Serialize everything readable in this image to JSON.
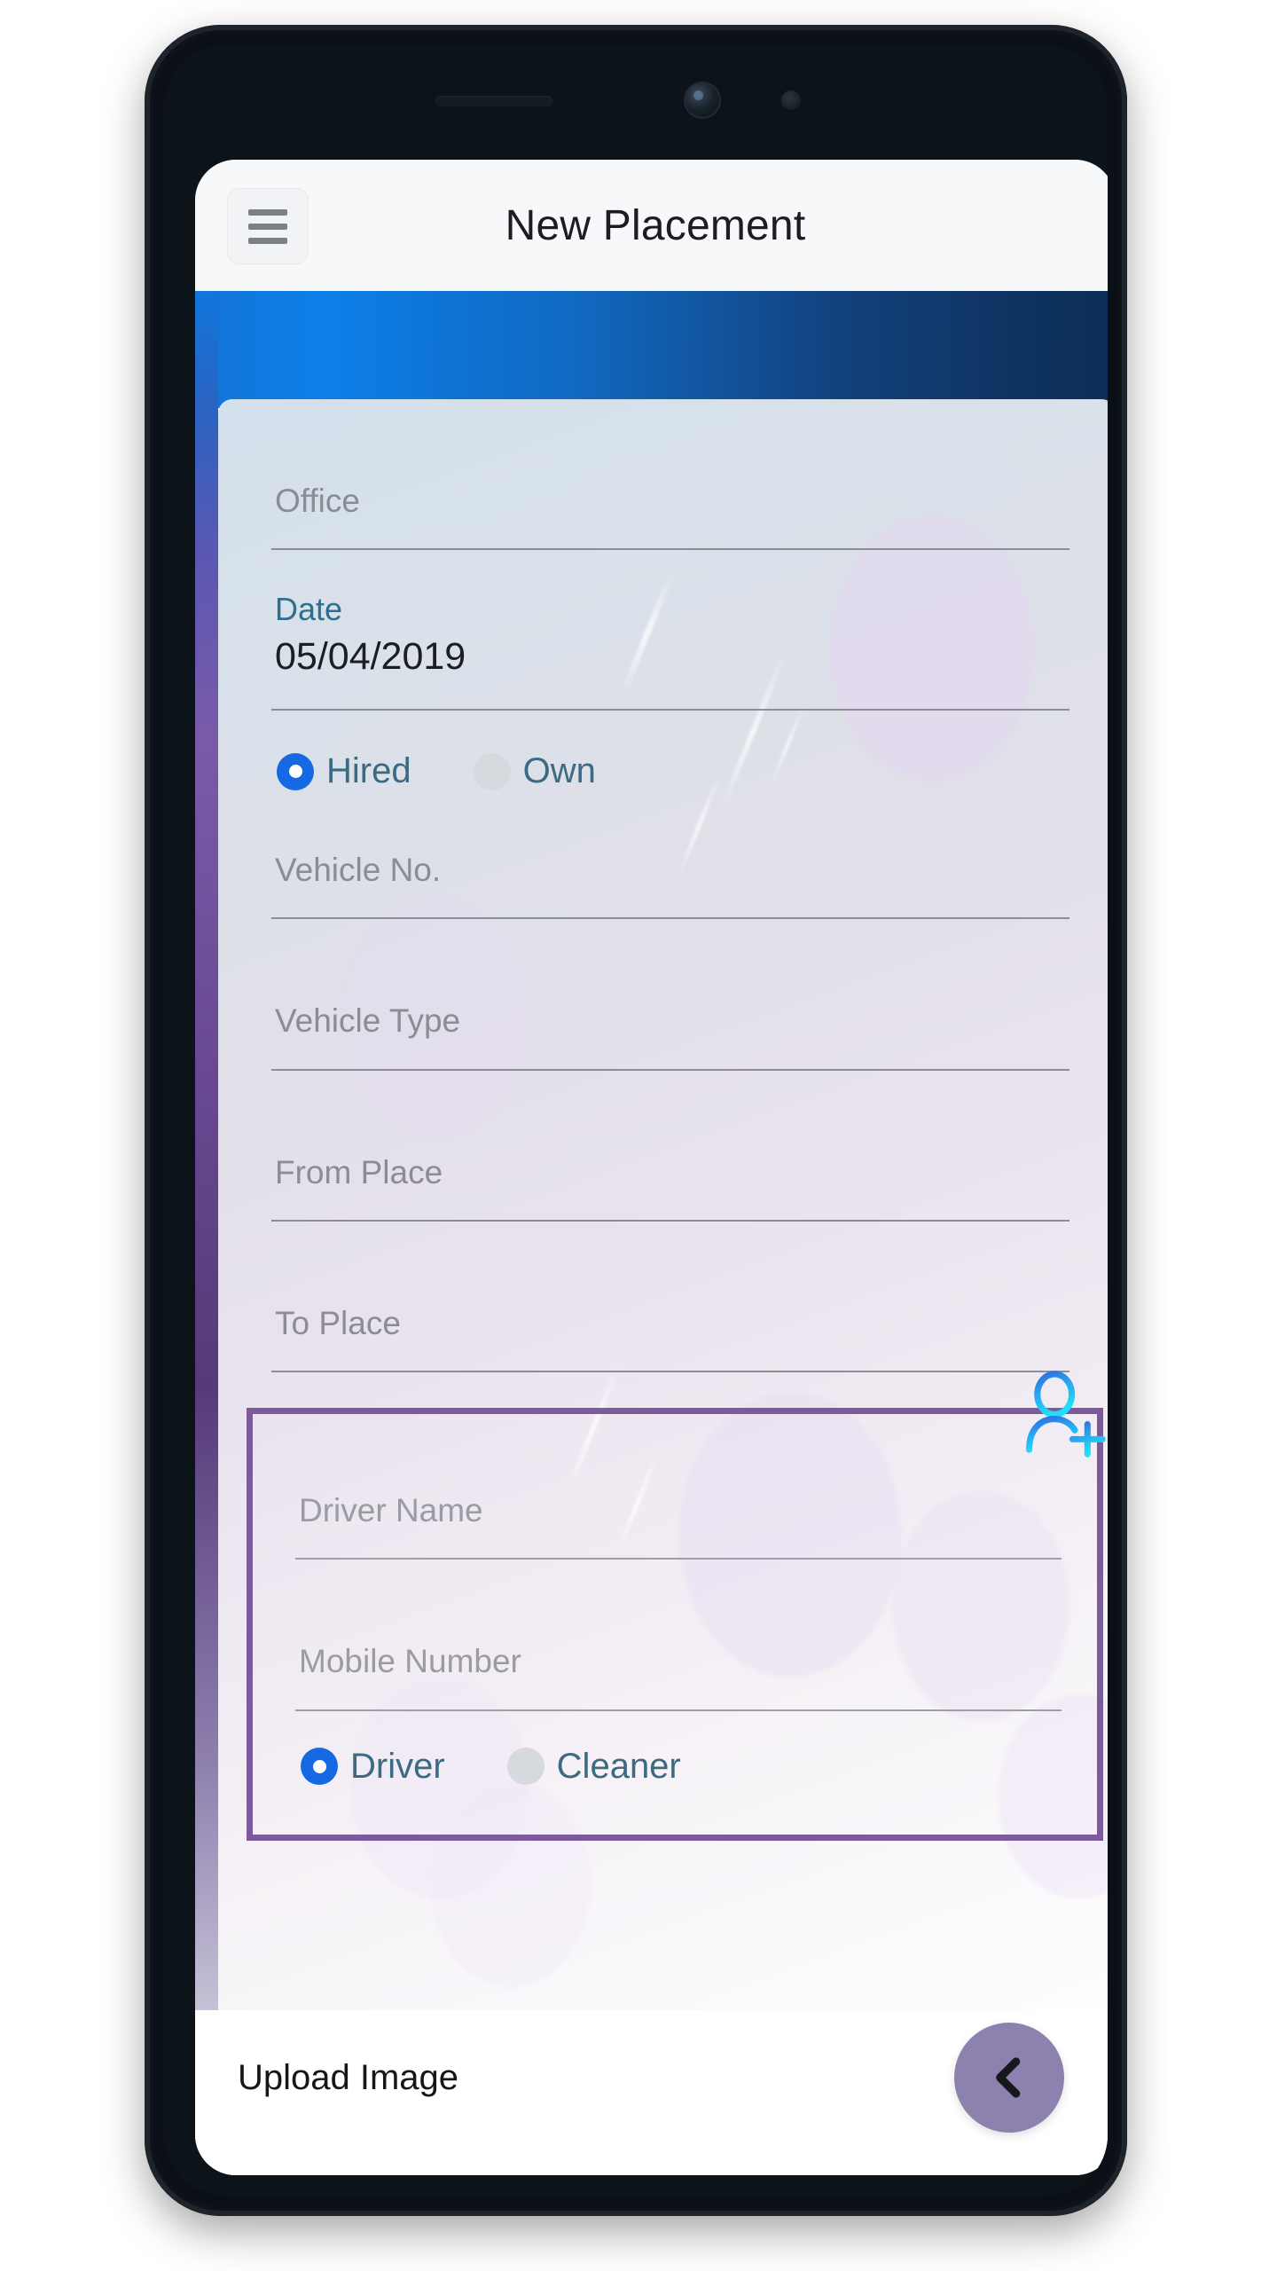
{
  "app": {
    "title": "New Placement",
    "menu_icon": "hamburger-icon"
  },
  "form": {
    "office": {
      "label": "Office",
      "value": ""
    },
    "date": {
      "label": "Date",
      "value": "05/04/2019"
    },
    "ownership": {
      "options": [
        {
          "label": "Hired",
          "selected": true
        },
        {
          "label": "Own",
          "selected": false
        }
      ]
    },
    "vehicle_no": {
      "label": "Vehicle No.",
      "value": ""
    },
    "vehicle_type": {
      "label": "Vehicle Type",
      "value": ""
    },
    "from_place": {
      "label": "From Place",
      "value": ""
    },
    "to_place": {
      "label": "To Place",
      "value": ""
    }
  },
  "driver_section": {
    "add_icon": "add-person-icon",
    "driver_name": {
      "label": "Driver Name",
      "value": ""
    },
    "mobile_number": {
      "label": "Mobile Number",
      "value": ""
    },
    "role": {
      "options": [
        {
          "label": "Driver",
          "selected": true
        },
        {
          "label": "Cleaner",
          "selected": false
        }
      ]
    }
  },
  "bottom": {
    "upload_label": "Upload Image",
    "back_icon": "arrow-left-icon"
  },
  "colors": {
    "accent_blue": "#1668e3",
    "header_blue": "#0c7fe8",
    "group_border_purple": "#7d5a9c",
    "fab_purple": "#8c82ad",
    "add_icon_cyan": "#22c7f5"
  }
}
